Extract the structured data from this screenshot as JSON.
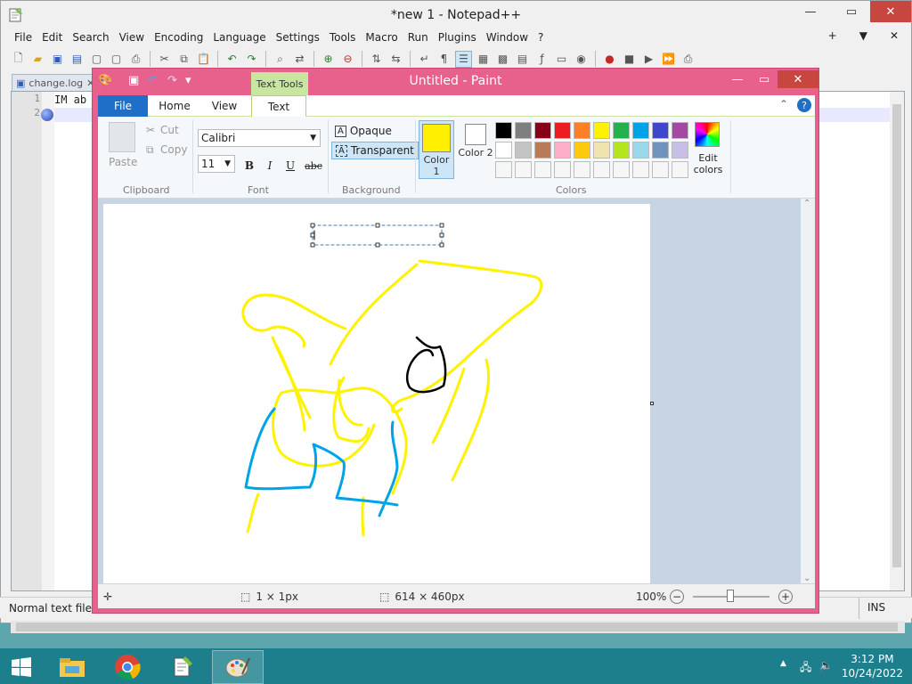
{
  "npp": {
    "title": "*new 1 - Notepad++",
    "menu": [
      "File",
      "Edit",
      "Search",
      "View",
      "Encoding",
      "Language",
      "Settings",
      "Tools",
      "Macro",
      "Run",
      "Plugins",
      "Window",
      "?"
    ],
    "menu_right": [
      "+",
      "▼",
      "✕"
    ],
    "tab": "change.log",
    "line_numbers": [
      "1",
      "2"
    ],
    "line1_text": "IM ab",
    "status_left": "Normal text file",
    "status_right": "INS"
  },
  "paint": {
    "title": "Untitled - Paint",
    "text_tools_label": "Text Tools",
    "tabs": [
      "File",
      "Home",
      "View",
      "Text"
    ],
    "clipboard": {
      "paste": "Paste",
      "cut": "Cut",
      "copy": "Copy",
      "group": "Clipboard"
    },
    "font": {
      "family": "Calibri",
      "size": "11",
      "group": "Font",
      "bold": "B",
      "italic": "I",
      "underline": "U",
      "strike": "abc"
    },
    "background": {
      "opaque": "Opaque",
      "transparent": "Transparent",
      "group": "Background"
    },
    "colors": {
      "color1_label": "Color 1",
      "color2_label": "Color 2",
      "color1": "#ffef00",
      "color2": "#ffffff",
      "edit_label": "Edit colors",
      "group": "Colors",
      "palette_row1": [
        "#000000",
        "#7f7f7f",
        "#880015",
        "#ed1c24",
        "#ff7f27",
        "#fff200",
        "#22b14c",
        "#00a2e8",
        "#3f48cc",
        "#a349a4"
      ],
      "palette_row2": [
        "#ffffff",
        "#c3c3c3",
        "#b97a57",
        "#ffaec9",
        "#ffc90e",
        "#efe4b0",
        "#b5e61d",
        "#99d9ea",
        "#7092be",
        "#c8bfe7"
      ]
    },
    "status": {
      "selection": "1 × 1px",
      "size": "614 × 460px",
      "zoom": "100%"
    }
  },
  "taskbar": {
    "time": "3:12 PM",
    "date": "10/24/2022"
  }
}
